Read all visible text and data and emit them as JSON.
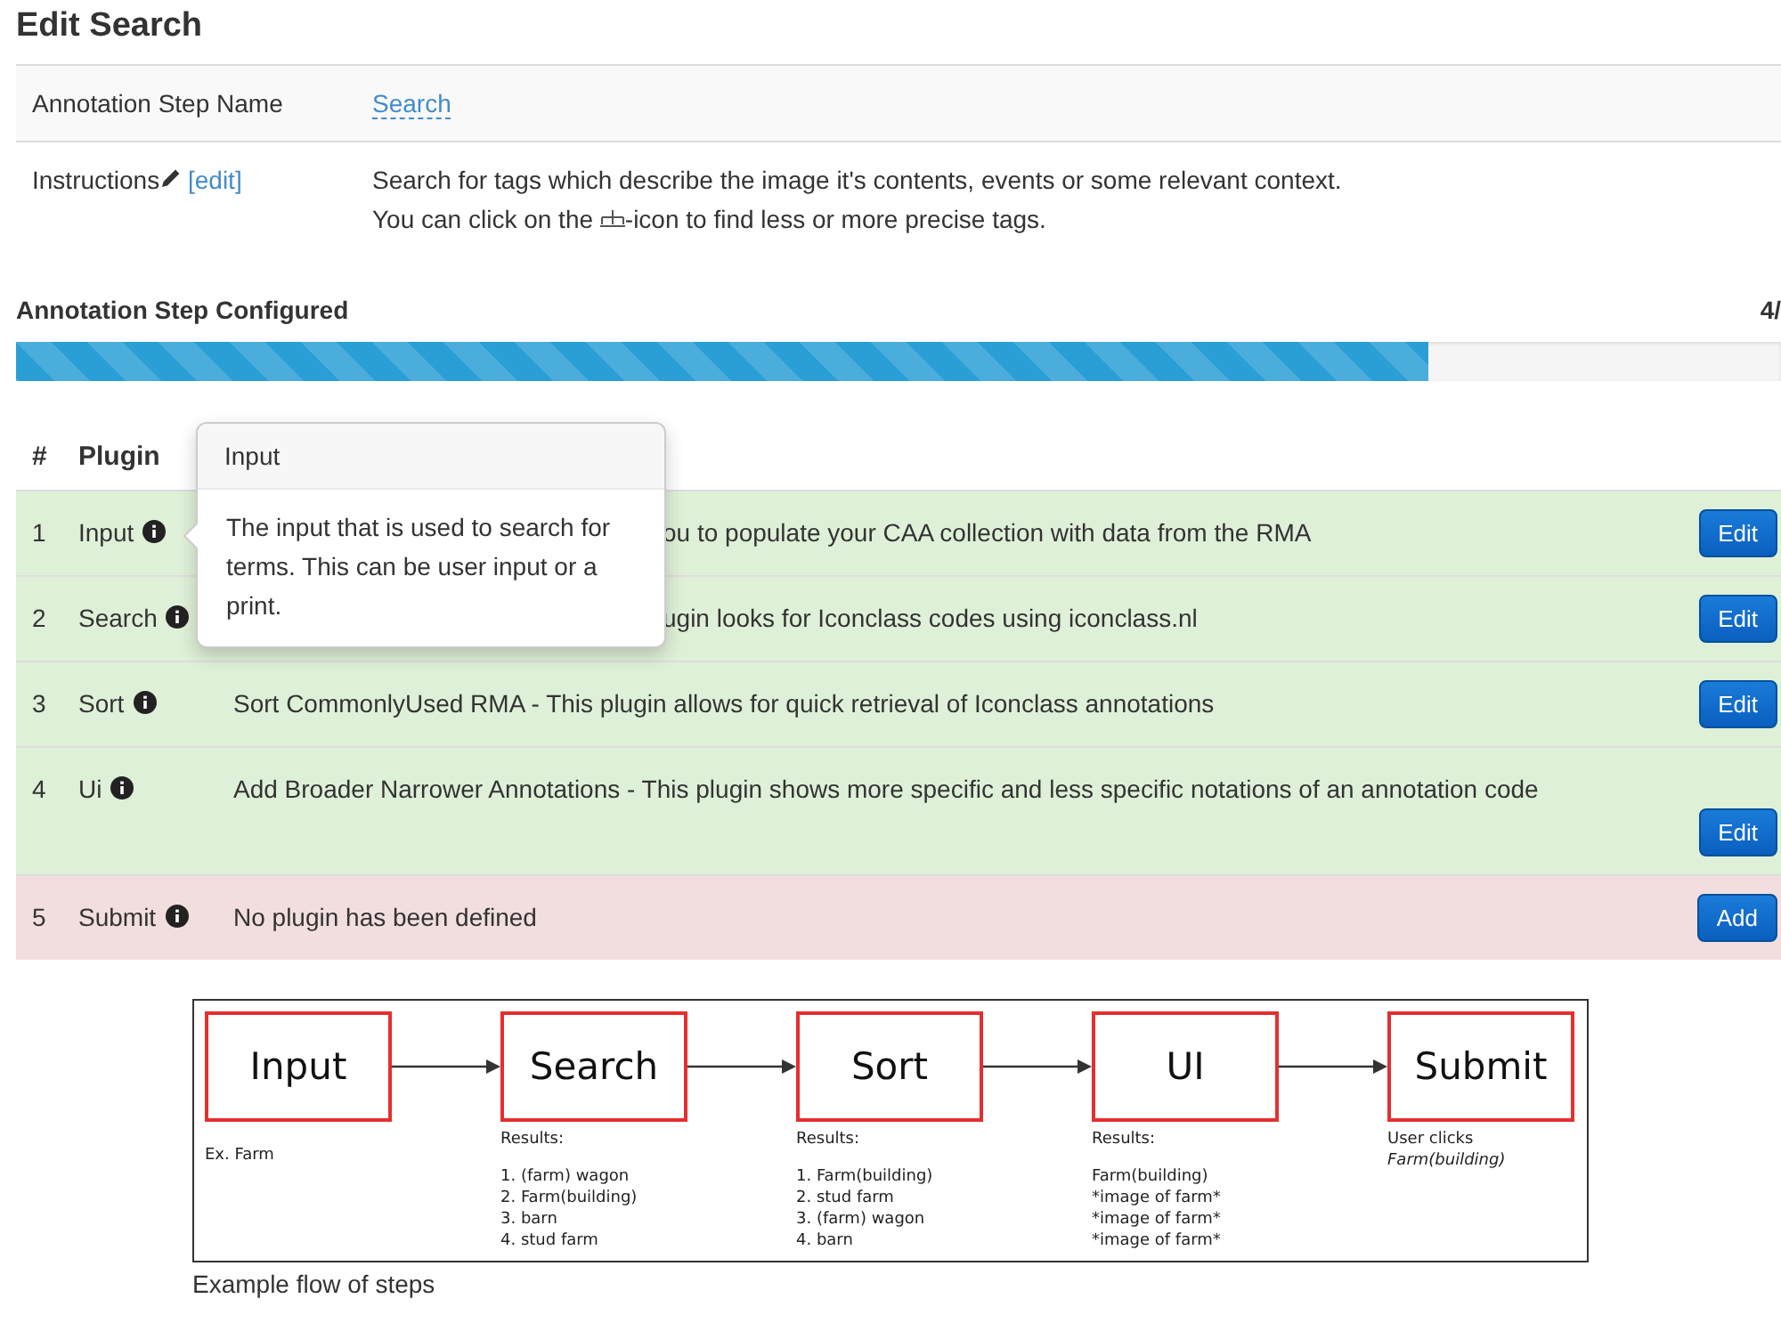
{
  "title": "Edit Search",
  "details": {
    "name_label": "Annotation Step Name",
    "name_value": "Search",
    "instructions_label": "Instructions",
    "edit_link": "[edit]",
    "instructions_line1": "Search for tags which describe the image it's contents, events or some relevant context.",
    "instructions_line2_before": "You can click on the ",
    "instructions_line2_after": "-icon to find less or more precise tags."
  },
  "progress": {
    "label": "Annotation Step Configured",
    "count": "4/",
    "level": 0.8
  },
  "table": {
    "columns": [
      "#",
      "Plugin"
    ],
    "rows": [
      {
        "number": "1",
        "plugin": "Input",
        "description": "ou to populate your CAA collection with data from the RMA",
        "covered": true,
        "defined": true,
        "button": "Edit"
      },
      {
        "number": "2",
        "plugin": "Search",
        "description": "ugin looks for Iconclass codes using iconclass.nl",
        "covered": true,
        "defined": true,
        "button": "Edit"
      },
      {
        "number": "3",
        "plugin": "Sort",
        "description": "Sort CommonlyUsed RMA - This plugin allows for quick retrieval of Iconclass annotations",
        "defined": true,
        "button": "Edit"
      },
      {
        "number": "4",
        "plugin": "Ui",
        "description": "Add Broader Narrower Annotations - This plugin shows more specific and less specific notations of an annotation code",
        "defined": true,
        "button": "Edit"
      },
      {
        "number": "5",
        "plugin": "Submit",
        "description": "No plugin has been defined",
        "defined": false,
        "button": "Add"
      }
    ]
  },
  "tooltip": {
    "title": "Input",
    "text": "The input that is used to search for terms. This can be user input or a print."
  },
  "flow": {
    "caption": "Example flow of steps",
    "steps": [
      {
        "label": "Input",
        "items": [
          "Ex. Farm"
        ]
      },
      {
        "label": "Search",
        "heading": "Results:",
        "items": [
          "1. (farm) wagon",
          "2. Farm(building)",
          "3. barn",
          "4. stud farm"
        ]
      },
      {
        "label": "Sort",
        "heading": "Results:",
        "items": [
          "1. Farm(building)",
          "2. stud farm",
          "3. (farm) wagon",
          "4. barn"
        ]
      },
      {
        "label": "UI",
        "heading": "Results:",
        "items": [
          "Farm(building)",
          "*image of farm*",
          "*image of farm*",
          "*image of farm*"
        ]
      },
      {
        "label": "Submit",
        "heading": "User clicks",
        "emphasis": "Farm(building)"
      }
    ]
  }
}
